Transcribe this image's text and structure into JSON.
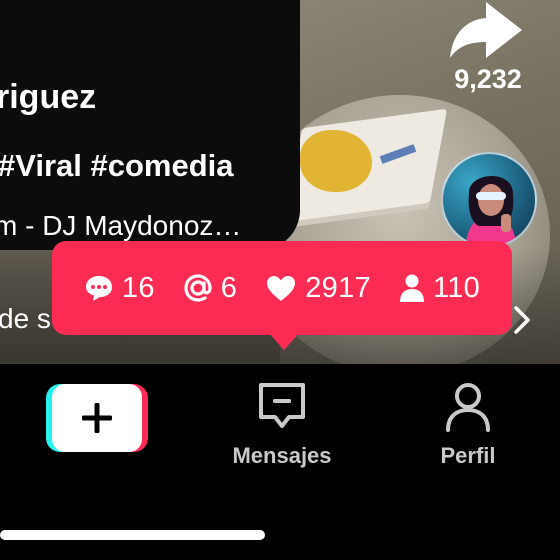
{
  "video": {
    "username": "riguez",
    "hashtags": "#Viral #comedia",
    "music": "m - DJ Maydonoz…",
    "subtitle": "de su"
  },
  "share": {
    "icon": "share-arrow-icon",
    "count": "9,232"
  },
  "tooltip": {
    "background": "#fe2c55",
    "stats": [
      {
        "icon": "comment-icon",
        "value": "16"
      },
      {
        "icon": "mention-icon",
        "value": "6"
      },
      {
        "icon": "heart-icon",
        "value": "2917"
      },
      {
        "icon": "person-icon",
        "value": "110"
      }
    ]
  },
  "nav": {
    "create": {
      "icon": "plus-icon"
    },
    "messages": {
      "icon": "inbox-icon",
      "label": "Mensajes"
    },
    "profile": {
      "icon": "profile-icon",
      "label": "Perfil"
    }
  },
  "colors": {
    "brand_pink": "#fe2c55",
    "brand_cyan": "#25f4ee",
    "nav_text": "#c9c9c9"
  }
}
